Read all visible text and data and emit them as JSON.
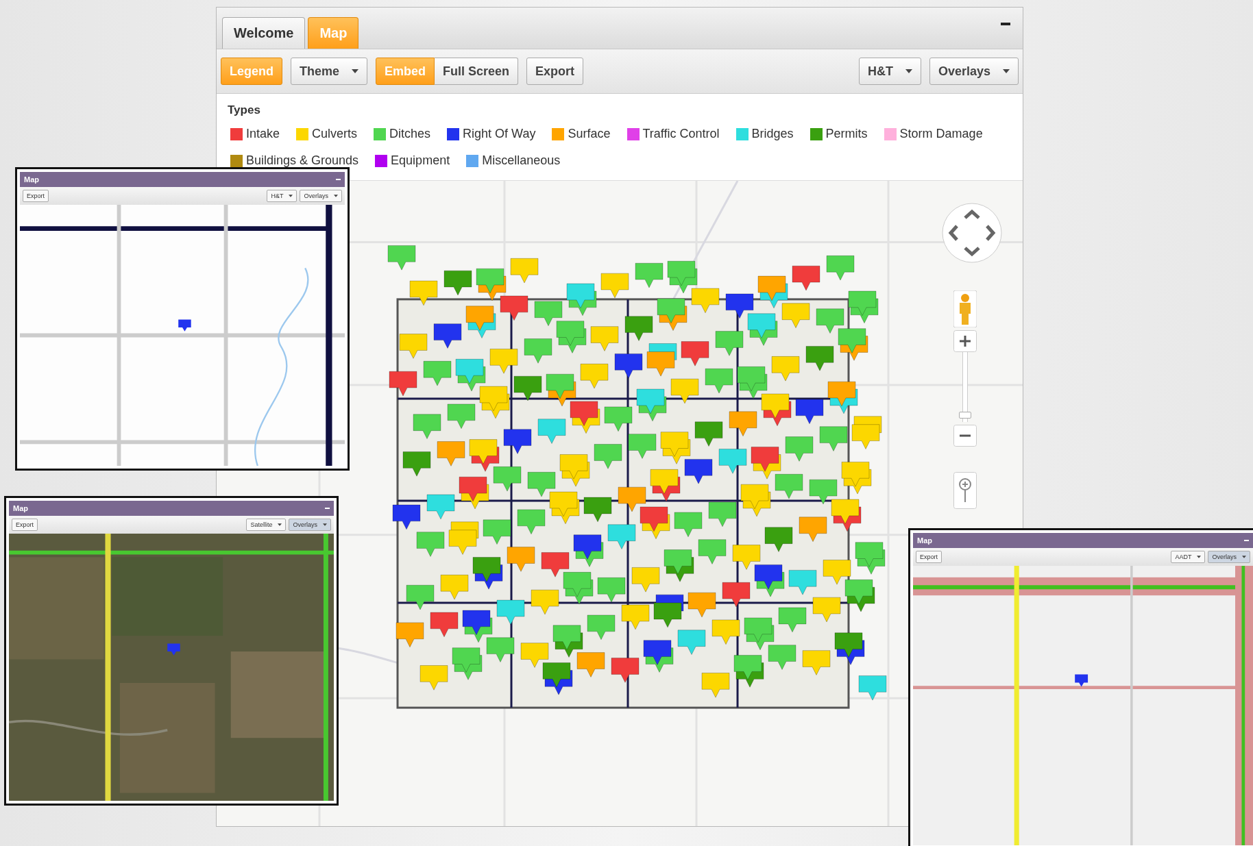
{
  "tabs": [
    {
      "label": "Welcome",
      "selected": false
    },
    {
      "label": "Map",
      "selected": true
    }
  ],
  "toolbar_left": [
    {
      "label": "Legend",
      "kind": "toggle",
      "selected": true
    },
    {
      "label": "Theme",
      "kind": "dropdown",
      "selected": false
    },
    {
      "label": "Embed",
      "kind": "segment",
      "selected": true
    },
    {
      "label": "Full Screen",
      "kind": "segment",
      "selected": false
    },
    {
      "label": "Export",
      "kind": "button",
      "selected": false
    }
  ],
  "toolbar_right": [
    {
      "label": "H&T",
      "kind": "dropdown",
      "selected": false
    },
    {
      "label": "Overlays",
      "kind": "dropdown",
      "selected": false
    }
  ],
  "zoom": {
    "level": 0.05
  },
  "legend": {
    "title": "Types",
    "types": [
      {
        "label": "Intake",
        "color": "#f03c3c"
      },
      {
        "label": "Culverts",
        "color": "#fcd700"
      },
      {
        "label": "Ditches",
        "color": "#50d650"
      },
      {
        "label": "Right Of Way",
        "color": "#2233ee"
      },
      {
        "label": "Surface",
        "color": "#ffa500"
      },
      {
        "label": "Traffic Control",
        "color": "#e040e8"
      },
      {
        "label": "Bridges",
        "color": "#2edede"
      },
      {
        "label": "Permits",
        "color": "#3aa010"
      },
      {
        "label": "Storm Damage",
        "color": "#ffb0dc"
      },
      {
        "label": "Buildings & Grounds",
        "color": "#b08a10"
      },
      {
        "label": "Equipment",
        "color": "#b000f0"
      },
      {
        "label": "Miscellaneous",
        "color": "#60a8f0"
      }
    ]
  },
  "insets": [
    {
      "title": "Map",
      "buttons": [
        "Export"
      ],
      "dropdowns": [
        {
          "label": "H&T",
          "selected": false
        },
        {
          "label": "Overlays",
          "selected": false
        }
      ]
    },
    {
      "title": "Map",
      "buttons": [
        "Export"
      ],
      "dropdowns": [
        {
          "label": "Satellite",
          "selected": false
        },
        {
          "label": "Overlays",
          "selected": true
        }
      ]
    },
    {
      "title": "Map",
      "buttons": [
        "Export"
      ],
      "dropdowns": [
        {
          "label": "AADT",
          "selected": false
        },
        {
          "label": "Overlays",
          "selected": true
        }
      ]
    }
  ]
}
